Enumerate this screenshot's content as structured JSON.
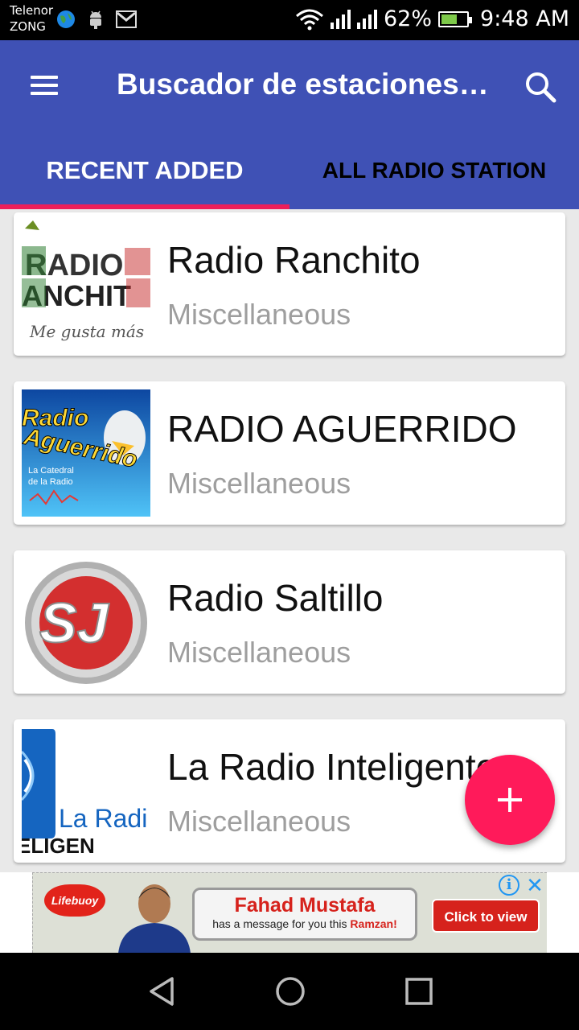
{
  "status_bar": {
    "carrier_line1": "Telenor",
    "carrier_line2": "ZONG",
    "battery_percent": "62%",
    "battery_level": 0.62,
    "time": "9:48 AM",
    "icons": [
      "globe-icon",
      "android-icon",
      "gmail-icon",
      "wifi-icon",
      "signal-icon",
      "signal-icon",
      "battery-charging-icon"
    ]
  },
  "app_bar": {
    "title": "Buscador de estaciones de radio",
    "menu_icon": "hamburger-menu-icon",
    "search_icon": "search-icon",
    "color": "#3f51b5"
  },
  "tabs": [
    {
      "label": "RECENT ADDED",
      "selected": true
    },
    {
      "label": "ALL RADIO STATION",
      "selected": false
    }
  ],
  "accent_color": "#ec1e5a",
  "stations": [
    {
      "name": "Radio Ranchito",
      "category": "Miscellaneous",
      "logo": "radio-ranchito-logo"
    },
    {
      "name": "RADIO AGUERRIDO",
      "category": "Miscellaneous",
      "logo": "radio-aguerrido-logo"
    },
    {
      "name": "Radio Saltillo",
      "category": "Miscellaneous",
      "logo": "sj-logo"
    },
    {
      "name": "La Radio Inteligente",
      "category": "Miscellaneous",
      "logo": "la-radio-inteligente-logo"
    }
  ],
  "fab": {
    "icon": "plus-icon",
    "color": "#ff1a5a"
  },
  "ad": {
    "brand": "Lifebuoy",
    "name": "Fahad Mustafa",
    "message_prefix": "has a message for you this",
    "message_highlight": "Ramzan!",
    "cta": "Click to view",
    "info_icon": "info-icon",
    "close_icon": "close-icon"
  },
  "nav_bar": {
    "icons": [
      "back-icon",
      "home-icon",
      "recents-icon"
    ]
  }
}
